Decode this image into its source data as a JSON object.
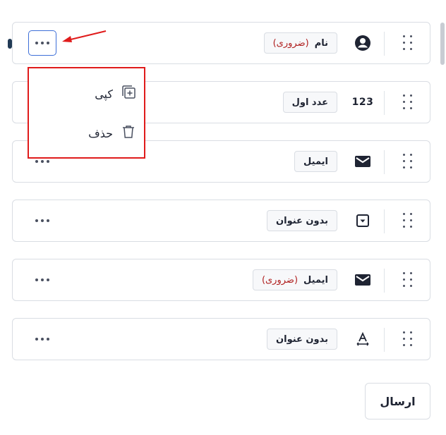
{
  "fields": [
    {
      "icon": "user-circle-icon",
      "label": "نام",
      "required_text": "(ضروری)",
      "menu_open": true
    },
    {
      "icon": "number-icon",
      "icon_text": "123",
      "label": "عدد اول",
      "required_text": ""
    },
    {
      "icon": "envelope-icon",
      "label": "ایمیل",
      "required_text": ""
    },
    {
      "icon": "dropdown-icon",
      "label": "بدون عنوان",
      "required_text": ""
    },
    {
      "icon": "envelope-icon",
      "label": "ایمیل",
      "required_text": "(ضروری)"
    },
    {
      "icon": "text-field-icon",
      "label": "بدون عنوان",
      "required_text": ""
    }
  ],
  "menu": {
    "copy_label": "کپی",
    "delete_label": "حذف"
  },
  "submit_label": "ارسال",
  "colors": {
    "annotation": "#e01b1b",
    "focus": "#3d6fd8",
    "required": "#b02020",
    "border": "#d9dde3"
  }
}
